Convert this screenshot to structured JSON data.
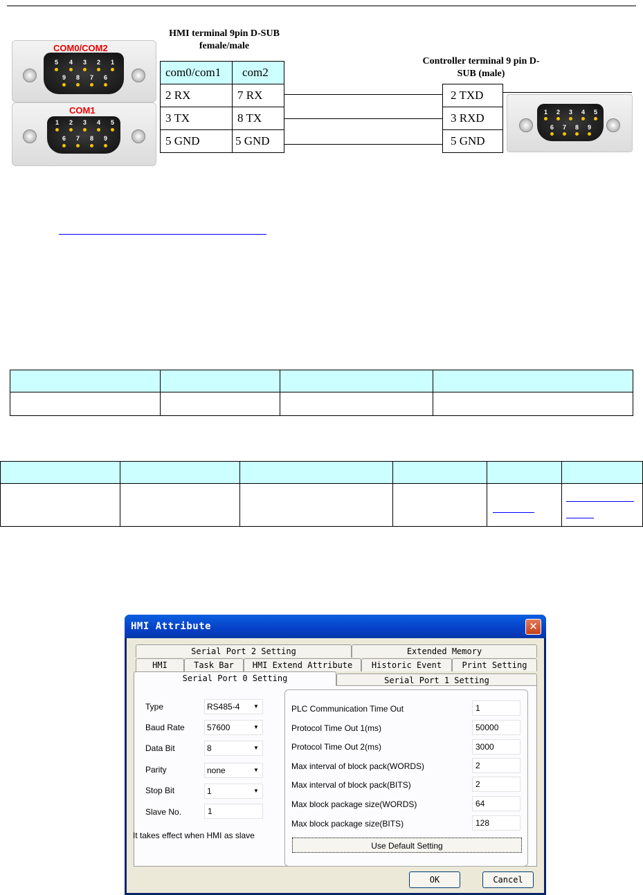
{
  "diagram": {
    "hmi_connectors": [
      {
        "label": "COM0/COM2",
        "pins_top": [
          "5",
          "4",
          "3",
          "2",
          "1"
        ],
        "pins_bottom": [
          "9",
          "8",
          "7",
          "6"
        ]
      },
      {
        "label": "COM1",
        "pins_top": [
          "1",
          "2",
          "3",
          "4",
          "5"
        ],
        "pins_bottom": [
          "6",
          "7",
          "8",
          "9"
        ]
      }
    ],
    "controller_connector": {
      "pins_top": [
        "1",
        "2",
        "3",
        "4",
        "5"
      ],
      "pins_bottom": [
        "6",
        "7",
        "8",
        "9"
      ]
    },
    "hmi_title": "HMI terminal 9pin D-SUB female/male",
    "controller_title": "Controller terminal 9 pin D-SUB (male)",
    "hmi_table": {
      "header": [
        "com0/com1",
        "com2"
      ],
      "rows": [
        [
          "2 RX",
          "7 RX"
        ],
        [
          "3 TX",
          "8 TX"
        ],
        [
          "5 GND",
          "5 GND"
        ]
      ]
    },
    "controller_table": [
      "2 TXD",
      "3 RXD",
      "5 GND"
    ],
    "colors": {
      "header_bg": "#ccffff",
      "connector_label": "#e00000",
      "link": "#0000ff"
    }
  },
  "dialog": {
    "title": "HMI Attribute",
    "tabs_row1": [
      "Serial Port 2 Setting",
      "Extended Memory"
    ],
    "tabs_row2": [
      "HMI",
      "Task Bar",
      "HMI Extend Attribute",
      "Historic Event",
      "Print Setting"
    ],
    "tabs_row3": [
      "Serial Port 0 Setting",
      "Serial Port 1 Setting"
    ],
    "left": {
      "type_label": "Type",
      "type_value": "RS485-4",
      "baud_label": "Baud Rate",
      "baud_value": "57600",
      "databit_label": "Data Bit",
      "databit_value": "8",
      "parity_label": "Parity",
      "parity_value": "none",
      "stopbit_label": "Stop Bit",
      "stopbit_value": "1",
      "slave_label": "Slave No.",
      "slave_value": "1",
      "note": "It takes effect when HMI as slave"
    },
    "right": {
      "rows": [
        {
          "label": "PLC Communication Time Out",
          "value": "1"
        },
        {
          "label": "Protocol Time Out 1(ms)",
          "value": "50000"
        },
        {
          "label": "Protocol Time Out 2(ms)",
          "value": "3000"
        },
        {
          "label": "Max interval of block pack(WORDS)",
          "value": "2"
        },
        {
          "label": "Max interval of block pack(BITS)",
          "value": "2"
        },
        {
          "label": "Max block package size(WORDS)",
          "value": "64"
        },
        {
          "label": "Max block package size(BITS)",
          "value": "128"
        }
      ],
      "default_button": "Use Default Setting"
    },
    "ok_button": "OK",
    "cancel_button": "Cancel"
  }
}
